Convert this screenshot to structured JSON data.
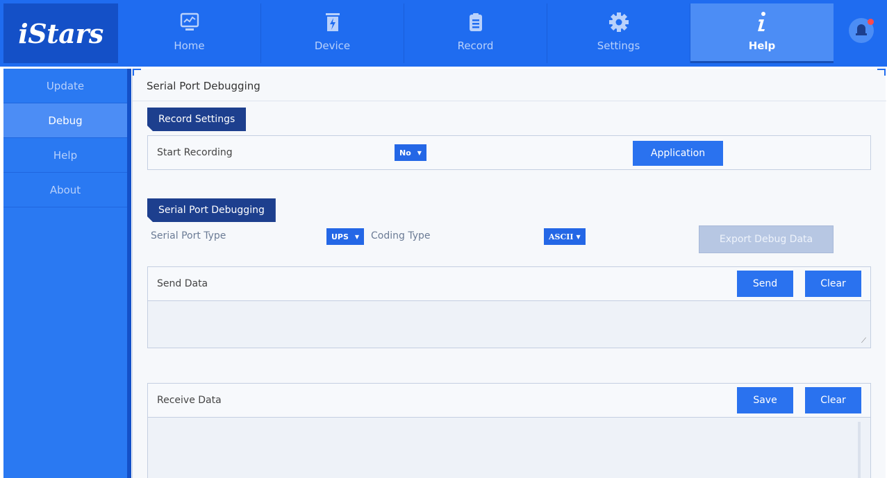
{
  "app": {
    "logo": "iStars"
  },
  "nav": {
    "items": [
      {
        "label": "Home",
        "icon": "monitor-chart-icon"
      },
      {
        "label": "Device",
        "icon": "battery-bolt-icon"
      },
      {
        "label": "Record",
        "icon": "clipboard-icon"
      },
      {
        "label": "Settings",
        "icon": "gear-icon"
      },
      {
        "label": "Help",
        "icon": "info-icon"
      }
    ],
    "active": "Help"
  },
  "sidebar": {
    "items": [
      {
        "label": "Update"
      },
      {
        "label": "Debug"
      },
      {
        "label": "Help"
      },
      {
        "label": "About"
      }
    ],
    "active": "Debug"
  },
  "main": {
    "title": "Serial Port Debugging",
    "record_settings": {
      "tab": "Record Settings",
      "start_recording_label": "Start Recording",
      "start_recording_value": "No",
      "apply_label": "Application"
    },
    "serial": {
      "tab": "Serial Port Debugging",
      "port_type_label": "Serial Port Type",
      "port_type_value": "UPS",
      "coding_type_label": "Coding Type",
      "coding_type_value": "ASCII",
      "export_label": "Export Debug Data"
    },
    "send": {
      "label": "Send Data",
      "send_button": "Send",
      "clear_button": "Clear"
    },
    "receive": {
      "label": "Receive Data",
      "save_button": "Save",
      "clear_button": "Clear"
    }
  },
  "colors": {
    "topbar": "#1f6cf0",
    "sidebar": "#2a79f2",
    "accent": "#2a72ef",
    "tab_dark": "#1d3f8e",
    "alert": "#ff4a4a"
  }
}
